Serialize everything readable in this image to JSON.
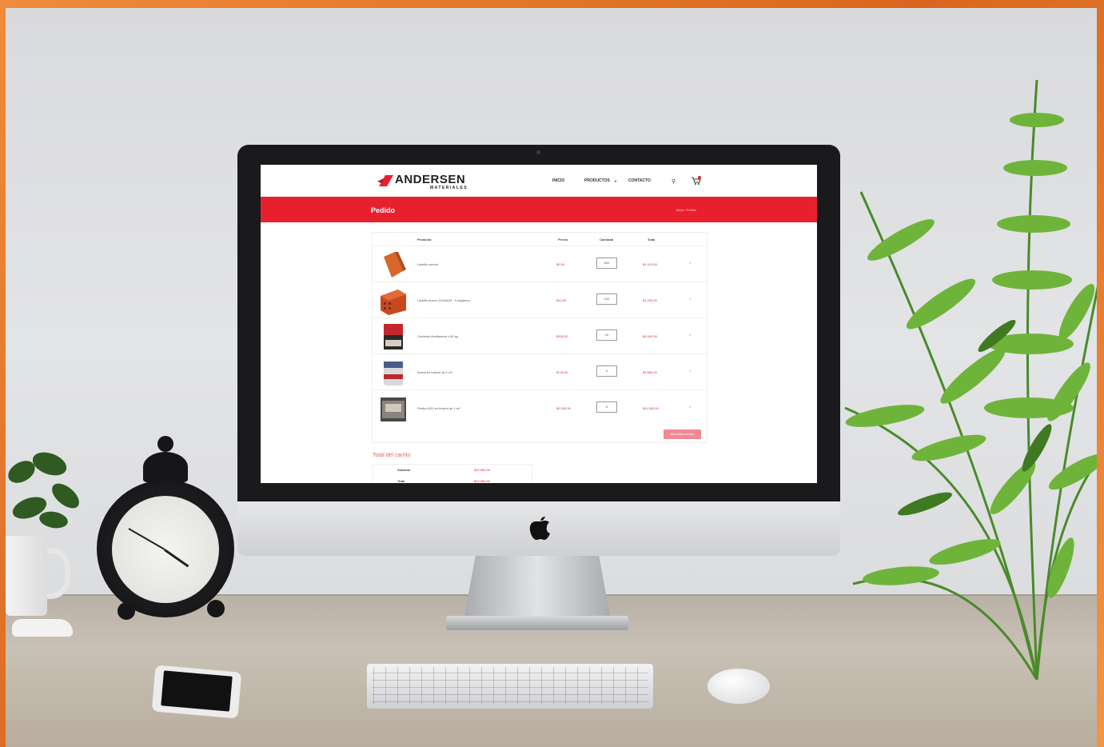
{
  "site": {
    "logo_text": "ANDERSEN",
    "logo_sub": "MATERIALES",
    "nav": [
      "INICIO",
      "PRODUCTOS",
      "CONTACTO"
    ],
    "page_title": "Pedido",
    "breadcrumbs": "Inicio / Pedido"
  },
  "cart": {
    "headers": {
      "product": "Producto",
      "price": "Precio",
      "qty": "Cantidad",
      "total": "Total"
    },
    "items": [
      {
        "name": "Ladrillo común",
        "price": "$2,59",
        "qty": "500",
        "total": "$1.313,00"
      },
      {
        "name": "Ladrillo hueco 12x18x33 - 9 agujeros",
        "price": "$12,90",
        "qty": "100",
        "total": "$1.290,00"
      },
      {
        "name": "Cemento Avellaneda x 50 kg",
        "price": "$330,00",
        "qty": "10",
        "total": "$3.300,00"
      },
      {
        "name": "Arena en bolsón de 1 m³",
        "price": "$716,00",
        "qty": "5",
        "total": "$3.580,00"
      },
      {
        "name": "Piedra 6/20 en bolsón de 1 m³",
        "price": "$2.300,00",
        "qty": "5",
        "total": "$11.500,00"
      }
    ],
    "update_label": "Actualizar carrito",
    "remove_symbol": "×"
  },
  "totals": {
    "title": "Total del carrito",
    "rows": [
      {
        "label": "Subtotal",
        "value": "$20.983,00"
      },
      {
        "label": "Total",
        "value": "$20.983,00"
      }
    ]
  },
  "colors": {
    "brand_red": "#e8202e",
    "frame_orange": "#e8793a"
  }
}
